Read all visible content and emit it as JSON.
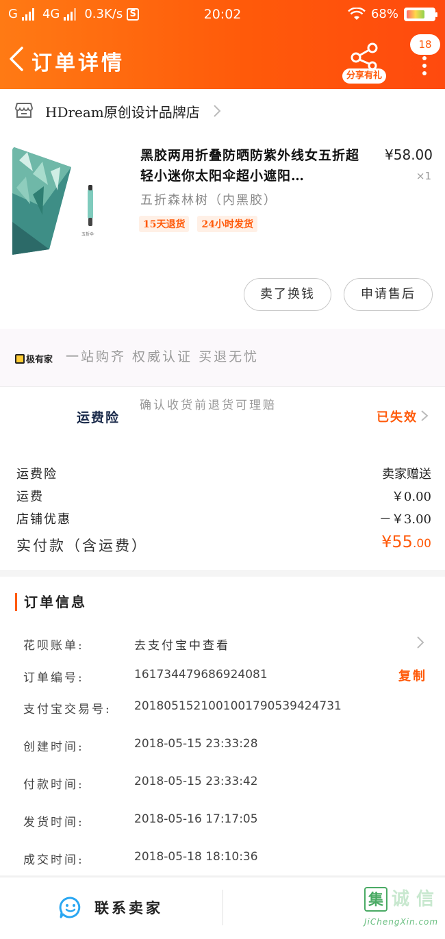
{
  "status_bar": {
    "carrier1": "G",
    "carrier2": "4G",
    "speed": "0.3K/s",
    "s_icon": "S",
    "time": "20:02",
    "battery": "68%"
  },
  "navbar": {
    "title": "订单详情",
    "share_label": "分享有礼",
    "badge_count": "18",
    "icons": [
      "back-chevron-icon",
      "share-icon",
      "more-dots-icon"
    ]
  },
  "store": {
    "name": "HDream原创设计品牌店",
    "icon": "store-icon"
  },
  "product": {
    "title": "黑胶两用折叠防晒防紫外线女五折超轻小迷你太阳伞超小遮阳…",
    "price": "¥58.00",
    "qty": "×1",
    "sku": "五折森林树（内黑胶）",
    "thumb_caption": "五折伞·内胶款",
    "tags": [
      "15天退货",
      "24小时发货"
    ]
  },
  "actions": {
    "resell": "卖了换钱",
    "aftersale": "申请售后"
  },
  "guarantee": {
    "logo_text": "极有家",
    "slogan": "一站购齐 权威认证 买退无忧"
  },
  "freight_insurance": {
    "label": "运费险",
    "desc": "确认收货前退货可理赔",
    "status": "已失效"
  },
  "fees": {
    "rows": [
      {
        "key": "运费险",
        "value": "卖家赠送"
      },
      {
        "key": "运费",
        "value": "￥0.00"
      },
      {
        "key": "店铺优惠",
        "value": "－￥3.00"
      }
    ],
    "total_key": "实付款（含运费）",
    "total_main": "¥55",
    "total_cents": ".00"
  },
  "order_info": {
    "title": "订单信息",
    "rows": [
      {
        "key": "花呗账单:",
        "value": "去支付宝中查看"
      },
      {
        "key": "订单编号:",
        "value": "161734479686924081",
        "action": "复制"
      },
      {
        "key": "支付宝交易号:",
        "value": "2018051521001001790539424731"
      },
      {
        "key": "创建时间:",
        "value": "2018-05-15 23:33:28"
      },
      {
        "key": "付款时间:",
        "value": "2018-05-15 23:33:42"
      },
      {
        "key": "发货时间:",
        "value": "2018-05-16 17:17:05"
      },
      {
        "key": "成交时间:",
        "value": "2018-05-18 18:10:36"
      }
    ]
  },
  "bottom_bar": {
    "contact_label": "联系卖家",
    "watermark_chars": [
      "集",
      "诚",
      "信"
    ],
    "watermark_url": "JiChengXin.com"
  },
  "colors": {
    "accent": "#ff5a0a",
    "header_gradient_start": "#ff7a14",
    "header_gradient_end": "#ff4a0e",
    "contact_icon": "#2aa7f2"
  }
}
